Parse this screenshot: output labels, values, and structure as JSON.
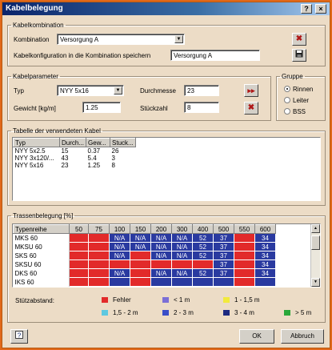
{
  "window": {
    "title": "Kabelbelegung"
  },
  "kabelkombination": {
    "legend": "Kabelkombination",
    "kombination_label": "Kombination",
    "kombination_value": "Versorgung A",
    "save_label": "Kabelkonfiguration in die Kombination speichern",
    "save_value": "Versorgung A"
  },
  "kabelparameter": {
    "legend": "Kabelparameter",
    "typ_label": "Typ",
    "typ_value": "NYY 5x16",
    "gewicht_label": "Gewicht [kg/m]",
    "gewicht_value": "1.25",
    "durchmesser_label": "Durchmesse",
    "durchmesser_value": "23",
    "stueckzahl_label": "Stückzahl",
    "stueckzahl_value": "8"
  },
  "gruppe": {
    "legend": "Gruppe",
    "options": [
      "Rinnen",
      "Leiter",
      "BSS"
    ],
    "selected": "Rinnen"
  },
  "kabel_table": {
    "legend": "Tabelle der verwendeten Kabel",
    "headers": [
      "Typ",
      "Durch...",
      "Gew...",
      "Stuck..."
    ],
    "rows": [
      [
        "NYY 5x2.5",
        "15",
        "0.37",
        "26"
      ],
      [
        "NYY 3x120/...",
        "43",
        "5.4",
        "3"
      ],
      [
        "NYY 5x16",
        "23",
        "1.25",
        "8"
      ]
    ]
  },
  "trassen": {
    "legend": "Trassenbelegung [%]",
    "headers": [
      "Typenreihe",
      "50",
      "75",
      "100",
      "150",
      "200",
      "300",
      "400",
      "500",
      "550",
      "600"
    ],
    "rows": [
      {
        "name": "MKS 60",
        "cells": [
          "",
          "",
          "N/A",
          "N/A",
          "N/A",
          "N/A",
          "52",
          "37",
          "",
          "34"
        ]
      },
      {
        "name": "MKSU 60",
        "cells": [
          "",
          "",
          "N/A",
          "N/A",
          "N/A",
          "N/A",
          "52",
          "37",
          "",
          "34"
        ]
      },
      {
        "name": "SKS 60",
        "cells": [
          "",
          "",
          "N/A",
          "",
          "N/A",
          "N/A",
          "52",
          "37",
          "",
          "34"
        ]
      },
      {
        "name": "SKSU 60",
        "cells": [
          "",
          "",
          "",
          "",
          "",
          "",
          "",
          "37",
          "",
          "34"
        ]
      },
      {
        "name": "DKS 60",
        "cells": [
          "",
          "",
          "N/A",
          "",
          "N/A",
          "N/A",
          "52",
          "37",
          "",
          "34"
        ]
      },
      {
        "name": "IKS 60",
        "cells": [
          "",
          "",
          "",
          "",
          "",
          "",
          "",
          "",
          "",
          ""
        ]
      }
    ],
    "row_colors": [
      [
        "#e22a2a",
        "#e22a2a",
        "#2a3aa0",
        "#2a3aa0",
        "#2a3aa0",
        "#2a3aa0",
        "#2a3aa0",
        "#2a3aa0",
        "#e22a2a",
        "#2a3aa0"
      ],
      [
        "#e22a2a",
        "#e22a2a",
        "#2a3aa0",
        "#2a3aa0",
        "#2a3aa0",
        "#2a3aa0",
        "#2a3aa0",
        "#2a3aa0",
        "#e22a2a",
        "#2a3aa0"
      ],
      [
        "#e22a2a",
        "#e22a2a",
        "#2a3aa0",
        "#e22a2a",
        "#2a3aa0",
        "#2a3aa0",
        "#2a3aa0",
        "#2a3aa0",
        "#e22a2a",
        "#2a3aa0"
      ],
      [
        "#e22a2a",
        "#e22a2a",
        "#e22a2a",
        "#e22a2a",
        "#e22a2a",
        "#e22a2a",
        "#e22a2a",
        "#2a3aa0",
        "#e22a2a",
        "#2a3aa0"
      ],
      [
        "#e22a2a",
        "#e22a2a",
        "#2a3aa0",
        "#e22a2a",
        "#2a3aa0",
        "#2a3aa0",
        "#2a3aa0",
        "#2a3aa0",
        "#e22a2a",
        "#2a3aa0"
      ],
      [
        "#e22a2a",
        "#e22a2a",
        "#2a3aa0",
        "#e22a2a",
        "#2a3aa0",
        "#2a3aa0",
        "#2a3aa0",
        "#2a3aa0",
        "#e22a2a",
        "#2a3aa0"
      ]
    ]
  },
  "stuetzabstand": {
    "label": "Stützabstand:",
    "items": [
      {
        "color": "#e22a2a",
        "text": "Fehler"
      },
      {
        "color": "#7b6fd6",
        "text": "< 1 m"
      },
      {
        "color": "#f2ea3c",
        "text": "1 - 1,5 m"
      },
      {
        "color": "#5ec8e0",
        "text": "1,5 - 2 m"
      },
      {
        "color": "#3a4ec8",
        "text": "2 - 3 m"
      },
      {
        "color": "#1c2a80",
        "text": "3 - 4 m"
      },
      {
        "color": "#2aa83a",
        "text": "> 5 m"
      }
    ]
  },
  "buttons": {
    "ok": "OK",
    "cancel": "Abbruch"
  },
  "icons": {
    "help": "help-icon",
    "delete": "delete-icon",
    "save": "save-disk-icon",
    "add": "add-cable-icon",
    "remove": "remove-cable-icon"
  }
}
